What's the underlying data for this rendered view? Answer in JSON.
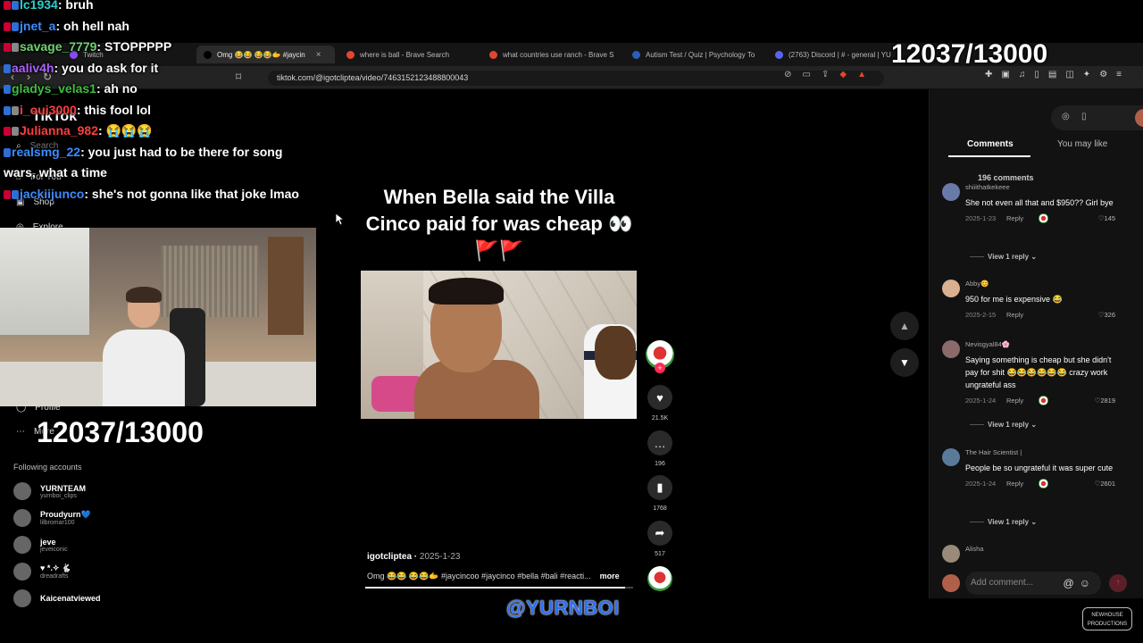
{
  "browser": {
    "tabs": [
      {
        "label": "Twitch",
        "color": "#8a4af3",
        "active": false
      },
      {
        "label": "Omg 😂😂 😂😂🫱 #jaycin",
        "color": "#000000",
        "active": true
      },
      {
        "label": "where is ball - Brave Search",
        "color": "#e2462e",
        "active": false
      },
      {
        "label": "what countries use ranch - Brave S",
        "color": "#e2462e",
        "active": false
      },
      {
        "label": "Autism Test / Quiz | Psychology To",
        "color": "#2a5fb8",
        "active": false
      },
      {
        "label": "(2763) Discord | # - general | YU",
        "color": "#5865f2",
        "active": false
      }
    ],
    "url": "tiktok.com/@igotcliptea/video/7463152123488800043"
  },
  "tiktok_nav": {
    "logo": "TikTok",
    "search": "Search",
    "for_you": "For You",
    "shop": "Shop",
    "explore": "Explore",
    "profile": "Profile",
    "more": "More",
    "following_header": "Following accounts",
    "accounts": [
      {
        "name": "YURNTEAM",
        "handle": "yurnboi_clips"
      },
      {
        "name": "Proudyurn💙",
        "handle": "lilbromar100"
      },
      {
        "name": "jeve",
        "handle": "jeveiconic"
      },
      {
        "name": "♥ *.✧ 🐇",
        "handle": "dreadrafts"
      },
      {
        "name": "Kaicenatviewed",
        "handle": ""
      }
    ]
  },
  "chat": [
    {
      "user": "lc1934",
      "color": "#2ad1d1",
      "msg": "bruh",
      "badges": [
        "r",
        "b"
      ]
    },
    {
      "user": "jnet_a",
      "color": "#3b8dff",
      "msg": "oh hell nah",
      "badges": [
        "r",
        "b"
      ]
    },
    {
      "user": "savage_7779",
      "color": "#6fd36f",
      "msg": "STOPPPPP",
      "badges": [
        "r",
        "g"
      ]
    },
    {
      "user": "aaliv4h",
      "color": "#b060ff",
      "msg": "you do ask for it",
      "badges": [
        "b"
      ]
    },
    {
      "user": "gladys_velas1",
      "color": "#3fbf3f",
      "msg": "ah no",
      "badges": [
        "b"
      ]
    },
    {
      "user": "i_oui3000",
      "color": "#ff3e3e",
      "msg": "this fool lol",
      "badges": [
        "b",
        "g"
      ]
    },
    {
      "user": "Julianna_982",
      "color": "#ff3e3e",
      "msg": "😭😭😭",
      "badges": [
        "r",
        "g"
      ]
    },
    {
      "user": "realsmg_22",
      "color": "#3b8dff",
      "msg": "you just had to be there for song wars, what a time",
      "badges": [
        "b"
      ]
    },
    {
      "user": "jackiijunco",
      "color": "#3b8dff",
      "msg": "she's not gonna like that joke lmao",
      "badges": [
        "r",
        "b"
      ]
    }
  ],
  "counters": {
    "left": "12037/13000",
    "top_right": "12037/13000"
  },
  "video": {
    "caption": "When Bella said the Villa Cinco paid for was cheap 👀🚩🚩",
    "author": "igotcliptea",
    "date": "2025-1-23",
    "description": "Omg 😂😂 😂😂🫱 #jaycincoo #jaycinco #bella #bali #reacti...",
    "more": "more",
    "progress": 0.97,
    "likes": "21.5K",
    "comments": "196",
    "saves": "1768",
    "shares": "517"
  },
  "panel": {
    "tab_comments": "Comments",
    "tab_you_may_like": "You may like",
    "comment_count": "196 comments",
    "reply_label": "Reply",
    "view_reply": "View 1 reply",
    "comments": [
      {
        "user": "shiiithatkekeee",
        "text": "She not even all that and $950?? Girl bye",
        "date": "2025-1-23",
        "likes": "145",
        "creator": true,
        "view_reply": true
      },
      {
        "user": "Abby😊",
        "text": "950 for me is expensive 😂",
        "date": "2025-2-15",
        "likes": "326",
        "creator": false,
        "view_reply": false
      },
      {
        "user": "Nevisgyal84🌸",
        "text": "Saying something is cheap but she didn't pay for shit 😂😂😂😂😂😂 crazy work ungrateful ass",
        "date": "2025-1-24",
        "likes": "2819",
        "creator": true,
        "view_reply": true
      },
      {
        "user": "The Hair Scientist |",
        "text": "People be so ungrateful it was super cute",
        "date": "2025-1-24",
        "likes": "2601",
        "creator": true,
        "view_reply": true
      },
      {
        "user": "Alisha",
        "text": "",
        "date": "",
        "likes": "",
        "creator": false,
        "view_reply": false
      }
    ],
    "add_comment_placeholder": "Add comment..."
  },
  "watermark": "@YURNBOI",
  "logo_text": "NEWHOUSE PRODUCTIONS"
}
